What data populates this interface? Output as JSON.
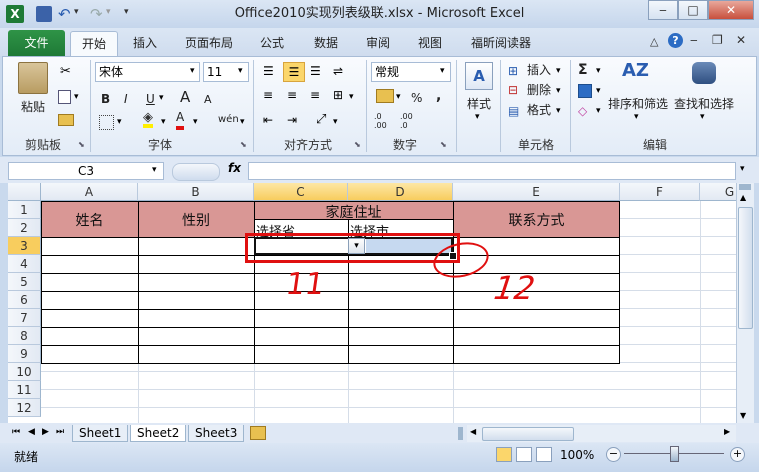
{
  "window": {
    "title": "Office2010实现列表级联.xlsx - Microsoft Excel"
  },
  "ribbon_tabs": [
    "文件",
    "开始",
    "插入",
    "页面布局",
    "公式",
    "数据",
    "审阅",
    "视图",
    "福昕阅读器"
  ],
  "clipboard": {
    "paste": "粘贴",
    "label": "剪贴板"
  },
  "font": {
    "name": "宋体",
    "size": "11",
    "label": "字体",
    "bold": "B",
    "italic": "I",
    "underline": "U",
    "grow": "A",
    "shrink": "A",
    "color_btn": "A",
    "phonetic": "wén"
  },
  "alignment": {
    "label": "对齐方式"
  },
  "number": {
    "format": "常规",
    "percent": "%",
    "comma": ",",
    "label": "数字",
    "dec_inc": ".0 .00",
    "dec_dec": ".00 .0"
  },
  "styles": {
    "label": "样式"
  },
  "cells": {
    "insert": "插入",
    "delete": "删除",
    "format": "格式",
    "label": "单元格"
  },
  "editing": {
    "sum": "Σ",
    "sort_filter": "排序和筛选",
    "find_select": "查找和选择",
    "label": "编辑"
  },
  "formula_bar": {
    "name_box": "C3",
    "fx": "fx",
    "content": ""
  },
  "columns": [
    "A",
    "B",
    "C",
    "D",
    "E",
    "F",
    "G"
  ],
  "rows": [
    "1",
    "2",
    "3",
    "4",
    "5",
    "6",
    "7",
    "8",
    "9",
    "10",
    "11",
    "12"
  ],
  "cells_text": {
    "a1": "姓名",
    "b1": "性别",
    "cd1": "家庭住址",
    "c2": "选择省",
    "d2": "选择市",
    "e1": "联系方式"
  },
  "annotations": {
    "mark1": "11",
    "mark2": "12",
    "color": "#e01010"
  },
  "sheet_tabs": [
    "Sheet1",
    "Sheet2",
    "Sheet3"
  ],
  "active_sheet": "Sheet2",
  "status": {
    "ready": "就绪",
    "zoom": "100%"
  },
  "colors": {
    "header_fill": "#d99795",
    "selected_header": "#f8cd5e",
    "file_tab": "#2a8a40"
  }
}
